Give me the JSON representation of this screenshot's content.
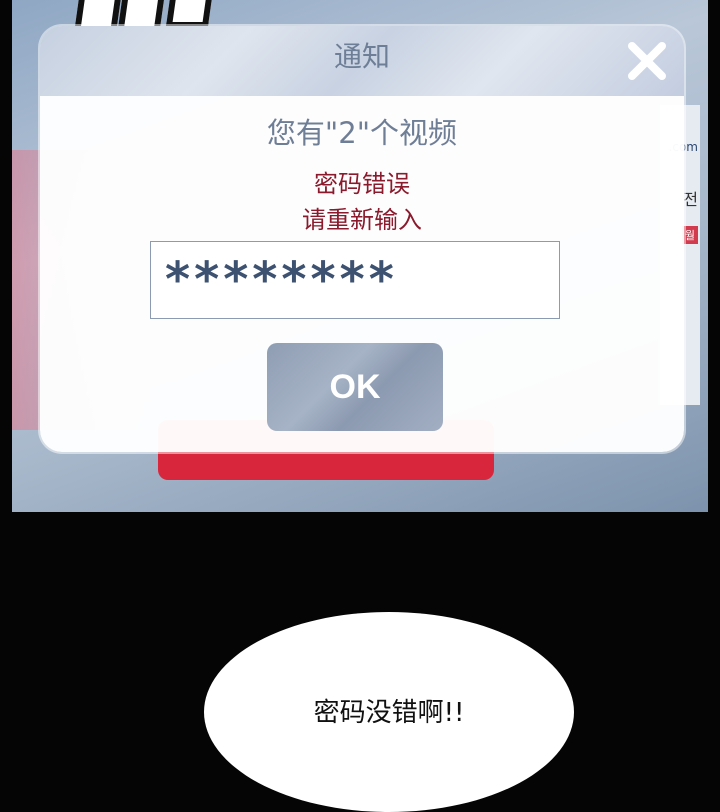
{
  "modal": {
    "title": "通知",
    "message": "您有\"2\"个视频",
    "error_line1": "密码错误",
    "error_line2": "请重新输入",
    "password_value": "********",
    "ok_label": "OK",
    "close_icon": "close-icon"
  },
  "background": {
    "right_text1": ".com",
    "right_text2": "전",
    "right_text3": "월"
  },
  "bubble": {
    "text": "密码没错啊!!"
  },
  "colors": {
    "title": "#6e7e96",
    "error": "#8a1a2c",
    "password": "#3d5271",
    "ok_button": "#9aa8bd"
  }
}
